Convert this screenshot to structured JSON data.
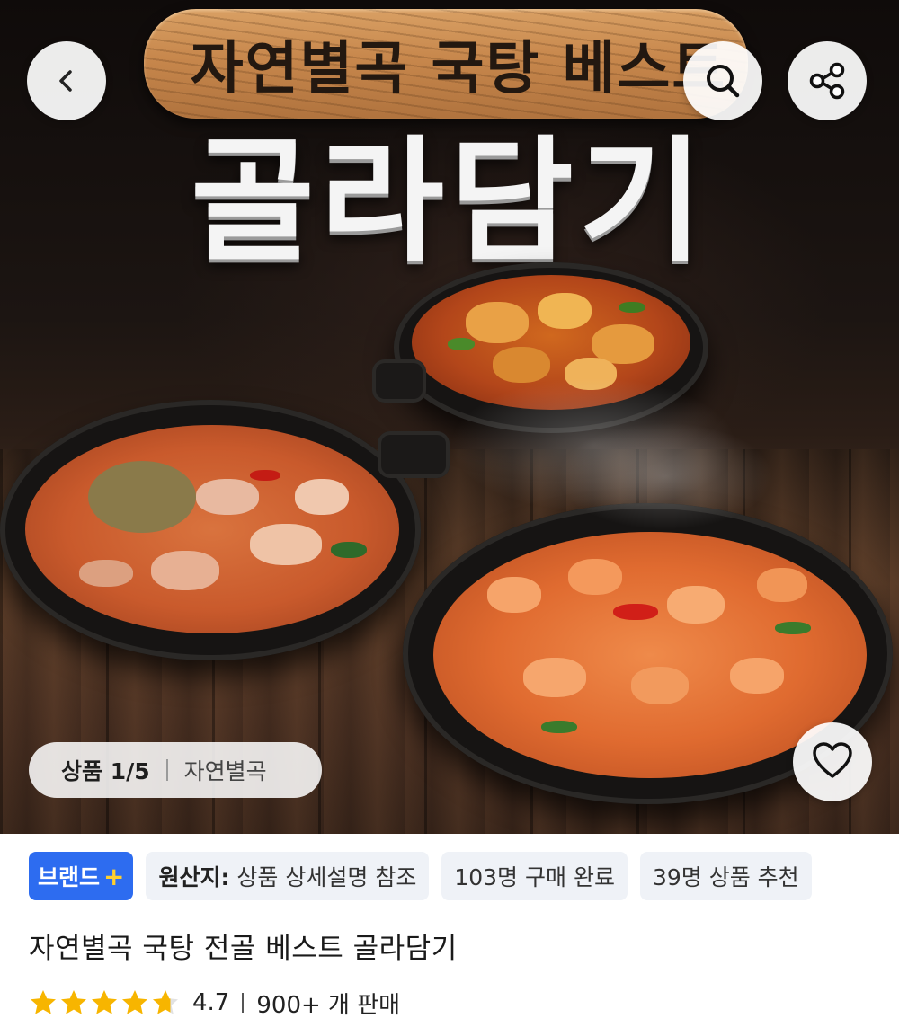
{
  "hero": {
    "board_text": "자연별곡 국탕 베스트",
    "big_title": "골라담기"
  },
  "icons": {
    "back": "chevron-left-icon",
    "search": "search-icon",
    "share": "share-icon",
    "wishlist": "heart-icon",
    "star": "star-icon"
  },
  "counter": {
    "label": "상품 1/5",
    "brand": "자연별곡"
  },
  "tags": {
    "brand": "브랜드",
    "brand_plus": "+",
    "origin_key": "원산지:",
    "origin_value": " 상품 상세설명 참조",
    "purchases": "103명 구매 완료",
    "recommend": "39명 상품 추천"
  },
  "product": {
    "title": "자연별곡 국탕 전골 베스트 골라담기",
    "rating": "4.7",
    "sold": "900+ 개 판매",
    "rating_value": 4.7,
    "rating_max": 5
  },
  "colors": {
    "brand_tag": "#2d6cf0",
    "plus": "#ffcf2e",
    "star": "#f7b500"
  }
}
